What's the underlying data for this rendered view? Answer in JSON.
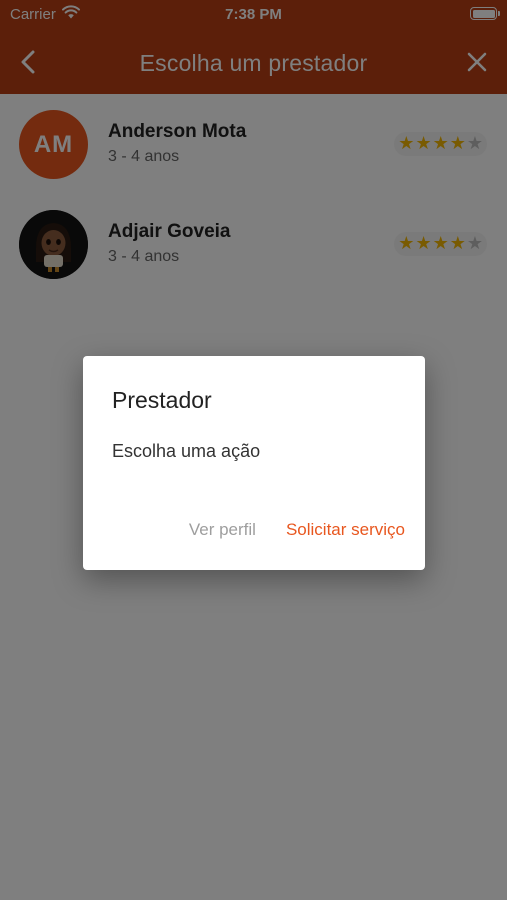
{
  "status_bar": {
    "carrier": "Carrier",
    "time": "7:38 PM"
  },
  "app_bar": {
    "title": "Escolha um prestador",
    "back_icon": "chevron-left-icon",
    "close_icon": "close-icon"
  },
  "providers": [
    {
      "name": "Anderson Mota",
      "experience": "3 - 4 anos",
      "avatar_initials": "AM",
      "rating": 4,
      "max_rating": 5
    },
    {
      "name": "Adjair Goveia",
      "experience": "3 - 4 anos",
      "avatar_initials": "",
      "rating": 4,
      "max_rating": 5
    }
  ],
  "dialog": {
    "title": "Prestador",
    "message": "Escolha uma ação",
    "secondary_action": "Ver perfil",
    "primary_action": "Solicitar serviço"
  },
  "colors": {
    "primary": "#b83e14",
    "accent": "#e8571f",
    "star": "#f2b705",
    "star_off": "#bdbdbd"
  }
}
